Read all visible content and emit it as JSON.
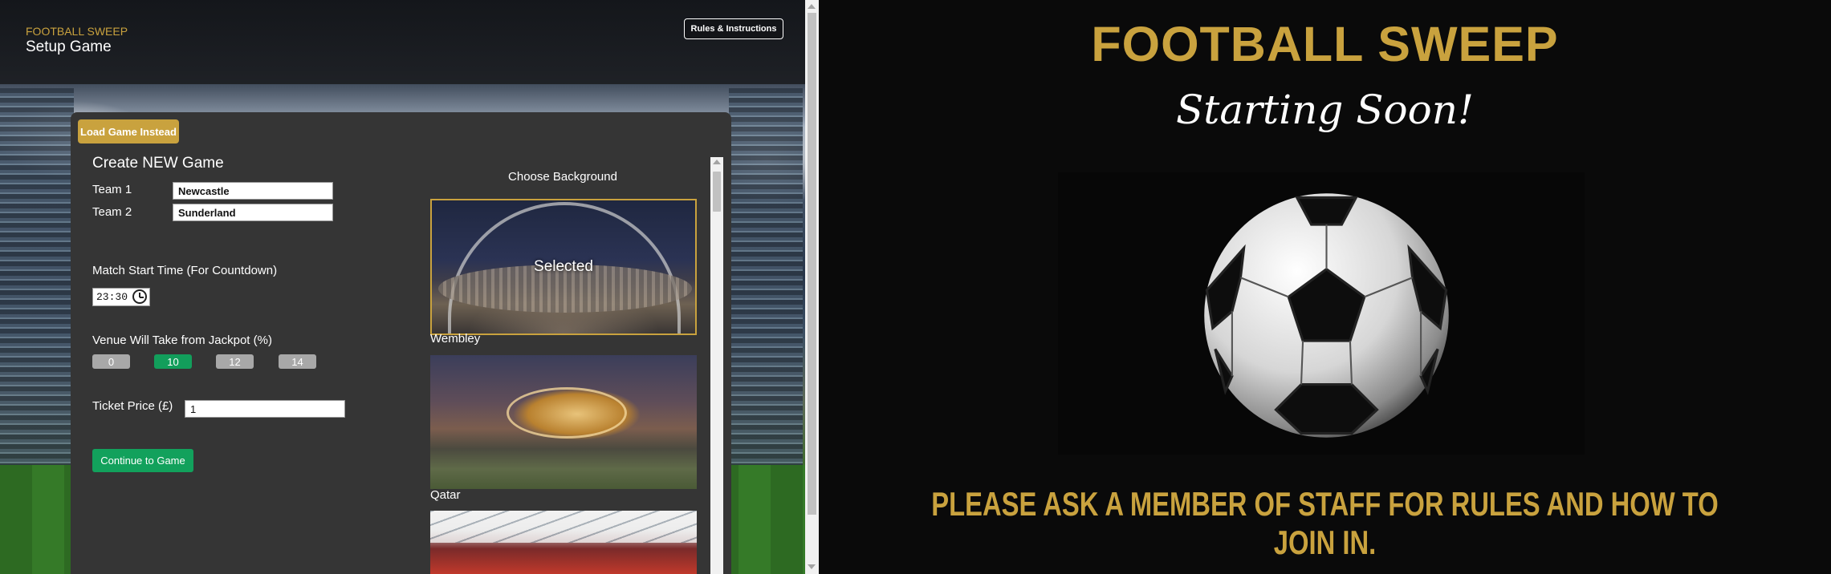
{
  "header": {
    "subtitle": "FOOTBALL SWEEP",
    "title": "Setup Game",
    "rules_button": "Rules & Instructions"
  },
  "panel": {
    "load_button": "Load Game Instead",
    "create_title": "Create NEW Game",
    "team1": {
      "label": "Team 1",
      "value": "Newcastle"
    },
    "team2": {
      "label": "Team 2",
      "value": "Sunderland"
    },
    "start_time": {
      "label": "Match Start Time (For Countdown)",
      "value": "23:30"
    },
    "venue_take": {
      "label": "Venue Will Take from Jackpot (%)",
      "options": [
        "0",
        "10",
        "12",
        "14"
      ],
      "selected": "10"
    },
    "ticket_price": {
      "label": "Ticket Price (£)",
      "value": "1"
    },
    "continue_button": "Continue to Game"
  },
  "backgrounds": {
    "heading": "Choose Background",
    "selected_label": "Selected",
    "items": [
      {
        "name": "Wembley",
        "selected": true
      },
      {
        "name": "Qatar",
        "selected": false
      }
    ]
  },
  "display": {
    "title": "FOOTBALL SWEEP",
    "subtitle": "Starting Soon!",
    "footer": "PLEASE ASK A MEMBER OF STAFF FOR RULES AND HOW TO JOIN IN.",
    "icon": "football-icon"
  },
  "colors": {
    "gold": "#c9a23e",
    "green": "#129e5b",
    "panel": "#353535"
  }
}
